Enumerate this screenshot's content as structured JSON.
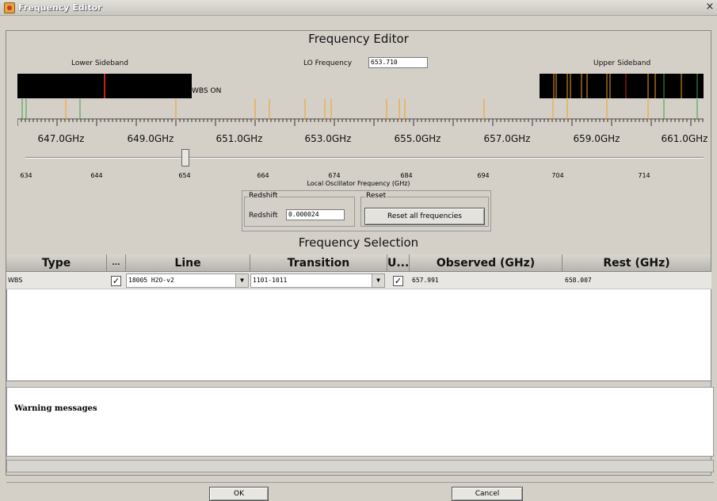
{
  "window": {
    "title": "Frequency Editor"
  },
  "editor": {
    "heading": "Frequency Editor",
    "lower_sideband_label": "Lower Sideband",
    "upper_sideband_label": "Upper Sideband",
    "lo_label": "LO Frequency",
    "lo_value": "653.710",
    "wbs_on_label": "WBS ON",
    "freq_ticks": [
      "647.0GHz",
      "649.0GHz",
      "651.0GHz",
      "653.0GHz",
      "655.0GHz",
      "657.0GHz",
      "659.0GHz",
      "661.0GHz"
    ],
    "slider_labels": [
      "634",
      "644",
      "654",
      "664",
      "674",
      "684",
      "694",
      "704",
      "714"
    ],
    "slider_axis_title": "Local Oscillator Frequency (GHz)"
  },
  "redshift": {
    "group_title": "Redshift",
    "label": "Redshift",
    "value": "0.000024"
  },
  "reset": {
    "group_title": "Reset",
    "button_label": "Reset all frequencies"
  },
  "selection": {
    "heading": "Frequency Selection",
    "columns": [
      "Type",
      "...",
      "Line",
      "Transition",
      "U...",
      "Observed (GHz)",
      "Rest (GHz)"
    ],
    "rows": [
      {
        "type": "WBS",
        "selected": true,
        "line": "18005  H2O-v2",
        "transition": "1101-1011",
        "use": true,
        "observed": "657.991",
        "rest": "658.007"
      }
    ]
  },
  "warnings": {
    "label": "Warning messages"
  },
  "buttons": {
    "ok": "OK",
    "cancel": "Cancel"
  },
  "colors": {
    "background": "#d4d0c8",
    "spectrum_black": "#000000",
    "line_orange": "#f0a020",
    "line_red": "#c52020",
    "line_green": "#40a040"
  }
}
